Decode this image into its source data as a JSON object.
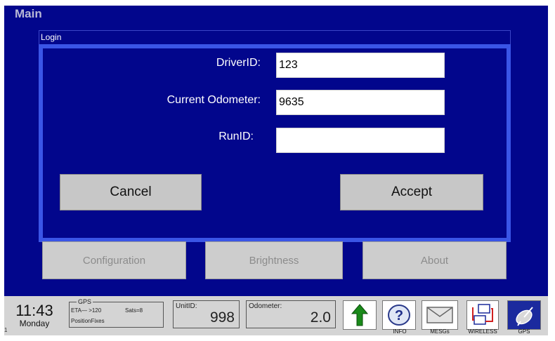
{
  "window": {
    "title": "Main"
  },
  "login": {
    "title": "Login",
    "fields": [
      {
        "label": "DriverID:",
        "value": "123"
      },
      {
        "label": "Current Odometer:",
        "value": "9635"
      },
      {
        "label": "RunID:",
        "value": ""
      }
    ],
    "cancel_label": "Cancel",
    "accept_label": "Accept"
  },
  "menu": {
    "configuration_label": "Configuration",
    "brightness_label": "Brightness",
    "about_label": "About"
  },
  "status": {
    "time": "11:43",
    "day": "Monday",
    "corner": "1",
    "gps": {
      "legend": "GPS",
      "eta": "ETA— >120",
      "sats": "Sats=8",
      "fixes": "PositionFixes"
    },
    "unit": {
      "label": "UnitID:",
      "value": "998"
    },
    "odometer": {
      "label": "Odometer:",
      "value": "2.0"
    },
    "icons": {
      "info": "INFO",
      "mesgs": "MESGs",
      "wireless": "WIRELESS",
      "gps": "GPS"
    }
  },
  "colors": {
    "screen_bg": "#02068c",
    "dialog_border": "#3a55e6",
    "button_bg": "#c7c7c7",
    "statusbar_bg": "#d4d4d4"
  }
}
